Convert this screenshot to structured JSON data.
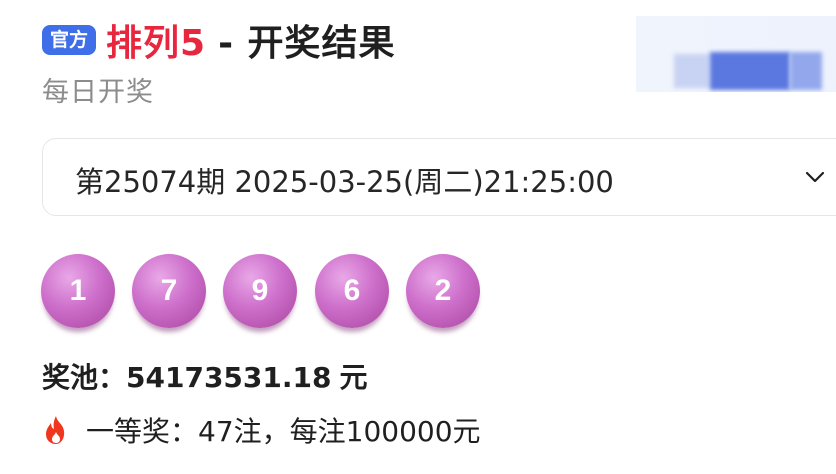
{
  "header": {
    "badge": "官方",
    "game_name": "排列5",
    "title_suffix": "- 开奖结果",
    "subtitle": "每日开奖"
  },
  "period": {
    "label": "第25074期 2025-03-25(周二)21:25:00"
  },
  "draw": {
    "numbers": [
      "1",
      "7",
      "9",
      "6",
      "2"
    ]
  },
  "pool": {
    "label": "奖池：",
    "amount": "54173531.18",
    "unit": "元"
  },
  "prize": {
    "text": "一等奖：47注，每注100000元"
  },
  "icons": {
    "fire": "fire-icon",
    "chevron": "chevron-down-icon"
  },
  "colors": {
    "badge": "#3f6fe8",
    "game_name": "#e8263d",
    "ball": "#cd6fcb"
  }
}
